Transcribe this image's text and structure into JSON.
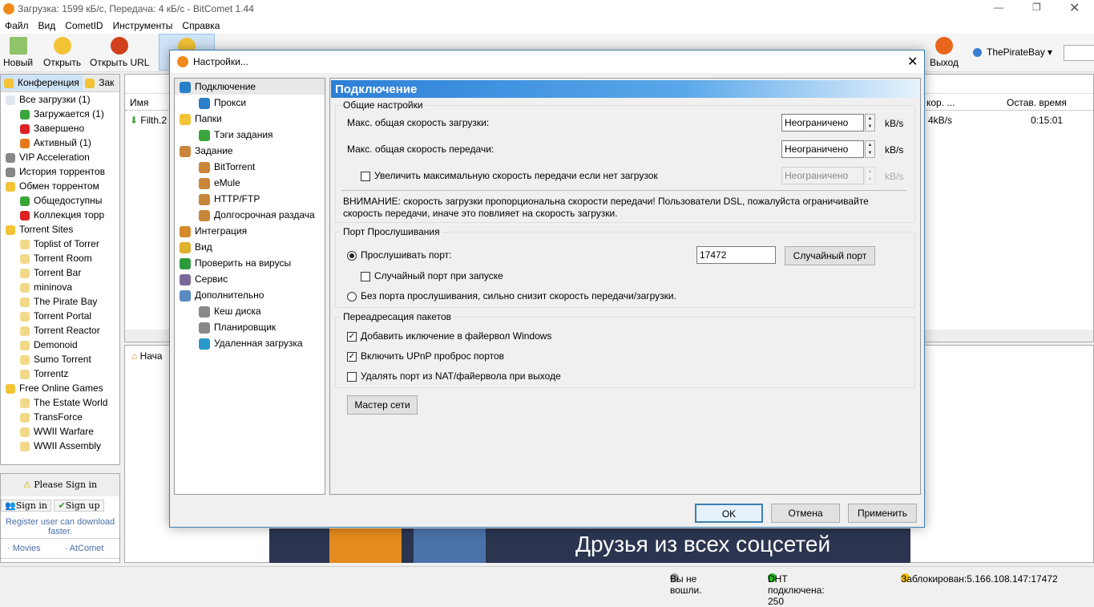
{
  "window": {
    "title": "Загрузка: 1599 кБ/с, Передача: 4 кБ/с - BitComet 1.44"
  },
  "menu": [
    "Файл",
    "Вид",
    "CometID",
    "Инструменты",
    "Справка"
  ],
  "toolbar": {
    "new": "Новый",
    "open": "Открыть",
    "open_url": "Открыть URL",
    "partial": "И",
    "exit": "Выход",
    "search_engine": "ThePirateBay"
  },
  "left": {
    "tabs": [
      "Конференция",
      "Зак"
    ],
    "items": [
      {
        "label": "Все загрузки (1)",
        "sub": false,
        "color": "#dfe6ee"
      },
      {
        "label": "Загружается (1)",
        "sub": true,
        "color": "#3aa53a"
      },
      {
        "label": "Завершено",
        "sub": true,
        "color": "#d22"
      },
      {
        "label": "Активный (1)",
        "sub": true,
        "color": "#e07a1a"
      },
      {
        "label": "VIP Acceleration",
        "sub": false,
        "color": "#888"
      },
      {
        "label": "История торрентов",
        "sub": false,
        "color": "#888"
      },
      {
        "label": "Обмен торрентом",
        "sub": false,
        "color": "#f2c335"
      },
      {
        "label": "Общедоступны",
        "sub": true,
        "color": "#3aa53a"
      },
      {
        "label": "Коллекция торр",
        "sub": true,
        "color": "#d22"
      },
      {
        "label": "Torrent Sites",
        "sub": false,
        "color": "#f2c335"
      },
      {
        "label": "Toplist of Torrer",
        "sub": true,
        "color": "#f2d98a"
      },
      {
        "label": "Torrent Room",
        "sub": true,
        "color": "#f2d98a"
      },
      {
        "label": "Torrent Bar",
        "sub": true,
        "color": "#f2d98a"
      },
      {
        "label": "mininova",
        "sub": true,
        "color": "#f2d98a"
      },
      {
        "label": "The Pirate Bay",
        "sub": true,
        "color": "#f2d98a"
      },
      {
        "label": "Torrent Portal",
        "sub": true,
        "color": "#f2d98a"
      },
      {
        "label": "Torrent Reactor",
        "sub": true,
        "color": "#f2d98a"
      },
      {
        "label": "Demonoid",
        "sub": true,
        "color": "#f2d98a"
      },
      {
        "label": "Sumo Torrent",
        "sub": true,
        "color": "#f2d98a"
      },
      {
        "label": "Torrentz",
        "sub": true,
        "color": "#f2d98a"
      },
      {
        "label": "Free Online Games",
        "sub": false,
        "color": "#f2c335"
      },
      {
        "label": "The Estate World",
        "sub": true,
        "color": "#f2d98a"
      },
      {
        "label": "TransForce",
        "sub": true,
        "color": "#f2d98a"
      },
      {
        "label": "WWII Warfare",
        "sub": true,
        "color": "#f2d98a"
      },
      {
        "label": "WWII Assembly",
        "sub": true,
        "color": "#f2d98a"
      }
    ]
  },
  "signin": {
    "please": "Please Sign in",
    "sign_in": "Sign in",
    "sign_up": "Sign up",
    "register": "Register user can download faster.",
    "link_movies": "· Movies",
    "link_atcomet": "· AtComet"
  },
  "list": {
    "col_name": "Имя",
    "col_speed": "кор. ...",
    "col_remaining": "Остав. время",
    "row_name": "Filth.2",
    "row_speed": "4kB/s",
    "row_remaining": "0:15:01"
  },
  "lower": {
    "tab": "Нача",
    "banner": "Друзья из всех соцсетей"
  },
  "status": {
    "login": "Вы не вошли.",
    "dht": "DHT подключена: 250",
    "blocked": "Заблокирован:5.166.108.147:17472"
  },
  "dialog": {
    "title": "Настройки...",
    "tree": [
      {
        "label": "Подключение",
        "sub": false,
        "color": "#2a7fc9"
      },
      {
        "label": "Прокси",
        "sub": true,
        "color": "#2a7fc9"
      },
      {
        "label": "Папки",
        "sub": false,
        "color": "#f2c335"
      },
      {
        "label": "Тэги задания",
        "sub": true,
        "color": "#3aa53a"
      },
      {
        "label": "Задание",
        "sub": false,
        "color": "#c9853a"
      },
      {
        "label": "BitTorrent",
        "sub": true,
        "color": "#c9853a"
      },
      {
        "label": "eMule",
        "sub": true,
        "color": "#c9853a"
      },
      {
        "label": "HTTP/FTP",
        "sub": true,
        "color": "#c9853a"
      },
      {
        "label": "Долгосрочная раздача",
        "sub": true,
        "color": "#c9853a"
      },
      {
        "label": "Интеграция",
        "sub": false,
        "color": "#d48a2a"
      },
      {
        "label": "Вид",
        "sub": false,
        "color": "#e0b030"
      },
      {
        "label": "Проверить на вирусы",
        "sub": false,
        "color": "#2e9a3e"
      },
      {
        "label": "Сервис",
        "sub": false,
        "color": "#7a6a9a"
      },
      {
        "label": "Дополнительно",
        "sub": false,
        "color": "#5a8ac0"
      },
      {
        "label": "Кеш диска",
        "sub": true,
        "color": "#888"
      },
      {
        "label": "Планировщик",
        "sub": true,
        "color": "#888"
      },
      {
        "label": "Удаленная загрузка",
        "sub": true,
        "color": "#2a9ac9"
      }
    ],
    "header": "Подключение",
    "general": {
      "legend": "Общие настройки",
      "max_down": "Макс. общая скорость загрузки:",
      "max_up": "Макс. общая скорость передачи:",
      "down_value": "Неограничено",
      "up_value": "Неограничено",
      "unit": "kB/s",
      "boost_label": "Увеличить максимальную скорость передачи если нет загрузок",
      "boost_checked": false,
      "boost_value": "Неограничено",
      "warning": "ВНИМАНИЕ: скорость загрузки пропорциональна скорости передачи! Пользователи DSL, пожалуйста ограничивайте скорость передачи, иначе это повлияет на скорость загрузки."
    },
    "port": {
      "legend": "Порт Прослушивания",
      "listen_label": "Прослушивать порт:",
      "listen_selected": true,
      "port_value": "17472",
      "random_button": "Случайный порт",
      "random_on_start": "Случайный порт при запуске",
      "random_on_start_checked": false,
      "no_port_label": "Без порта прослушивания, сильно снизит скорость передачи/загрузки."
    },
    "forward": {
      "legend": "Переадресация пакетов",
      "firewall": "Добавить иключение в файервол Windows",
      "firewall_checked": true,
      "upnp": "Включить UPnP проброс портов",
      "upnp_checked": true,
      "remove": "Удалять порт из NAT/файервола при выходе",
      "remove_checked": false
    },
    "wizard_button": "Мастер сети",
    "ok": "OK",
    "cancel": "Отмена",
    "apply": "Применить"
  }
}
